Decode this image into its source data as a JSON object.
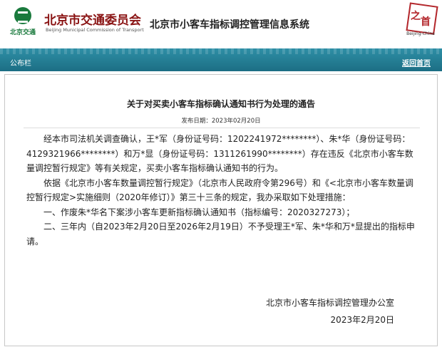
{
  "header": {
    "logo_text": "北京交通",
    "org_name": "北京市交通委员会",
    "org_name_en": "Beijing Municipal Commission of Transport",
    "system_title": "北京市小客车指标调控管理信息系统",
    "badge_caption": "Beijing-China"
  },
  "nav": {
    "tab_label": "公布栏",
    "back_label": "返回首页"
  },
  "notice": {
    "title": "关于对买卖小客车指标确认通知书行为处理的通告",
    "publish_date": "发布日期：2023年02月20日",
    "paragraphs": [
      "经本市司法机关调查确认，王*军（身份证号码：1202241972********）、朱*华（身份证号码：4129321966********）和万*显（身份证号码：1311261990********）存在违反《北京市小客车数量调控暂行规定》等有关规定，买卖小客车指标确认通知书的行为。",
      "依据《北京市小客车数量调控暂行规定》（北京市人民政府令第296号）和《<北京市小客车数量调控暂行规定>实施细则（2020年修订）》第三十三条的规定，我办采取如下处理措施：",
      "一、作废朱*华名下案涉小客车更新指标确认通知书（指标编号：2020327273）；",
      "二、三年内（自2023年2月20日至2026年2月19日）不予受理王*军、朱*华和万*显提出的指标申请。"
    ],
    "signature_org": "北京市小客车指标调控管理办公室",
    "signature_date": "2023年2月20日"
  }
}
